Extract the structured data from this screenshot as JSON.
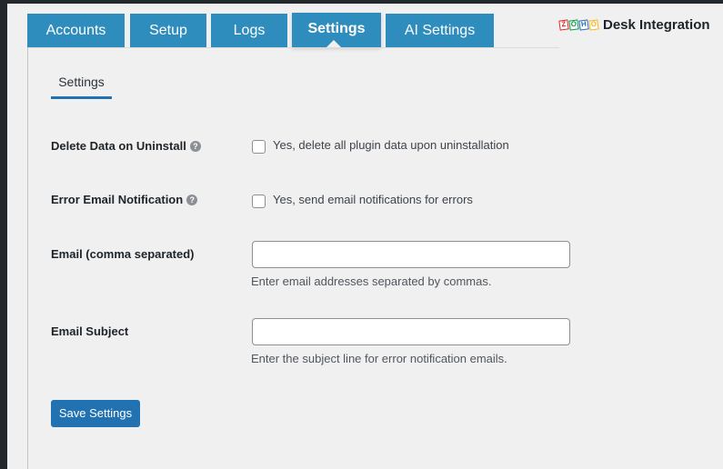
{
  "tabs": [
    {
      "label": "Accounts"
    },
    {
      "label": "Setup"
    },
    {
      "label": "Logs"
    },
    {
      "label": "Settings"
    },
    {
      "label": "AI Settings"
    }
  ],
  "active_tab": "Settings",
  "brand": {
    "logo_letters": [
      "Z",
      "O",
      "H",
      "O"
    ],
    "logo_colors": [
      "#e42527",
      "#089949",
      "#226db4",
      "#f9b21d"
    ],
    "text": "Desk Integration"
  },
  "subtab": {
    "label": "Settings"
  },
  "settings": {
    "delete_data": {
      "label": "Delete Data on Uninstall",
      "checkbox_text": "Yes, delete all plugin data upon uninstallation",
      "checked": false
    },
    "error_email": {
      "label": "Error Email Notification",
      "checkbox_text": "Yes, send email notifications for errors",
      "checked": false
    },
    "email": {
      "label": "Email (comma separated)",
      "value": "",
      "description": "Enter email addresses separated by commas."
    },
    "email_subject": {
      "label": "Email Subject",
      "value": "",
      "description": "Enter the subject line for error notification emails."
    }
  },
  "help_icon_glyph": "?",
  "save_button": {
    "label": "Save Settings"
  },
  "colors": {
    "tab_bg": "#2e8dbd",
    "primary_button": "#2271b1",
    "page_bg": "#f0f0f1"
  }
}
